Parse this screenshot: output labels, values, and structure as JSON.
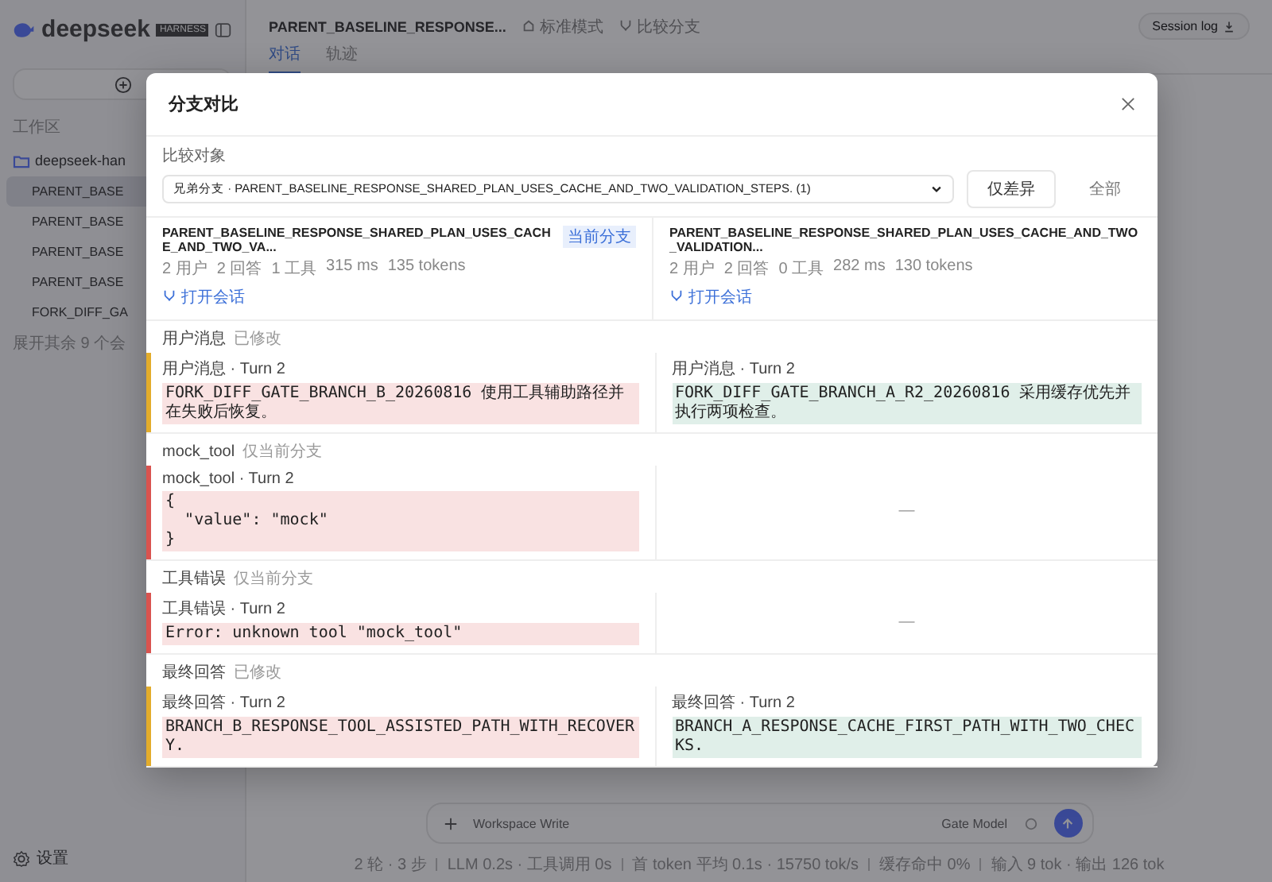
{
  "sidebar": {
    "logo": "deepseek",
    "badge": "HARNESS",
    "workspace_label": "工作区",
    "folder": "deepseek-han",
    "sessions": [
      {
        "title": "PARENT_BASE",
        "selected": true
      },
      {
        "title": "PARENT_BASE",
        "selected": false
      },
      {
        "title": "PARENT_BASE",
        "selected": false
      },
      {
        "title": "PARENT_BASE",
        "selected": false
      },
      {
        "title": "FORK_DIFF_GA",
        "selected": false
      }
    ],
    "more": "展开其余 9 个会",
    "settings": "设置"
  },
  "header": {
    "title": "PARENT_BASELINE_RESPONSE...",
    "mode": "标准模式",
    "compare": "比较分支",
    "tabs": [
      {
        "label": "对话",
        "selected": true
      },
      {
        "label": "轨迹",
        "selected": false
      }
    ],
    "session_log": "Session log"
  },
  "composer": {
    "mode": "Workspace Write",
    "model": "Gate Model"
  },
  "status_bar": [
    "2 轮 · 3 步",
    "LLM 0.2s · 工具调用 0s",
    "首 token 平均 0.1s · 15750 tok/s",
    "缓存命中 0%",
    "输入 9 tok · 输出 126 tok"
  ],
  "dialog": {
    "title": "分支对比",
    "compare_label": "比较对象",
    "compare_value": "兄弟分支 · PARENT_BASELINE_RESPONSE_SHARED_PLAN_USES_CACHE_AND_TWO_VALIDATION_STEPS. (1)",
    "filters": [
      {
        "label": "仅差异",
        "selected": true
      },
      {
        "label": "全部",
        "selected": false
      }
    ],
    "branches": [
      {
        "name": "PARENT_BASELINE_RESPONSE_SHARED_PLAN_USES_CACHE_AND_TWO_VA...",
        "badge": "当前分支",
        "stats": [
          "2 用户",
          "2 回答",
          "1 工具",
          "315 ms",
          "135 tokens"
        ],
        "open": "打开会话"
      },
      {
        "name": "PARENT_BASELINE_RESPONSE_SHARED_PLAN_USES_CACHE_AND_TWO_VALIDATION...",
        "stats": [
          "2 用户",
          "2 回答",
          "0 工具",
          "282 ms",
          "130 tokens"
        ],
        "open": "打开会话"
      }
    ],
    "sections": [
      {
        "title": "用户消息",
        "tag": "已修改",
        "color": "#e3ac2b",
        "left": {
          "kind": "content",
          "label": "用户消息 · Turn 2",
          "lines": [
            "FORK_DIFF_GATE_BRANCH_B_20260816 使用工具辅助路径并在失败后恢复。"
          ]
        },
        "right": {
          "kind": "content",
          "label": "用户消息 · Turn 2",
          "lines": [
            "FORK_DIFF_GATE_BRANCH_A_R2_20260816 采用缓存优先并执行两项检查。"
          ]
        }
      },
      {
        "title": "mock_tool",
        "tag": "仅当前分支",
        "color": "#d9534f",
        "left": {
          "kind": "content",
          "label": "mock_tool · Turn 2",
          "lines": [
            "{",
            "  \"value\": \"mock\"",
            "}"
          ]
        },
        "right": {
          "kind": "empty",
          "text": "—"
        }
      },
      {
        "title": "工具错误",
        "tag": "仅当前分支",
        "color": "#d9534f",
        "left": {
          "kind": "content",
          "label": "工具错误 · Turn 2",
          "lines": [
            "Error: unknown tool \"mock_tool\""
          ]
        },
        "right": {
          "kind": "empty",
          "text": "—"
        }
      },
      {
        "title": "最终回答",
        "tag": "已修改",
        "color": "#e3ac2b",
        "left": {
          "kind": "content",
          "label": "最终回答 · Turn 2",
          "lines": [
            "BRANCH_B_RESPONSE_TOOL_ASSISTED_PATH_WITH_RECOVERY."
          ]
        },
        "right": {
          "kind": "content",
          "label": "最终回答 · Turn 2",
          "lines": [
            "BRANCH_A_RESPONSE_CACHE_FIRST_PATH_WITH_TWO_CHECKS."
          ]
        }
      }
    ]
  }
}
